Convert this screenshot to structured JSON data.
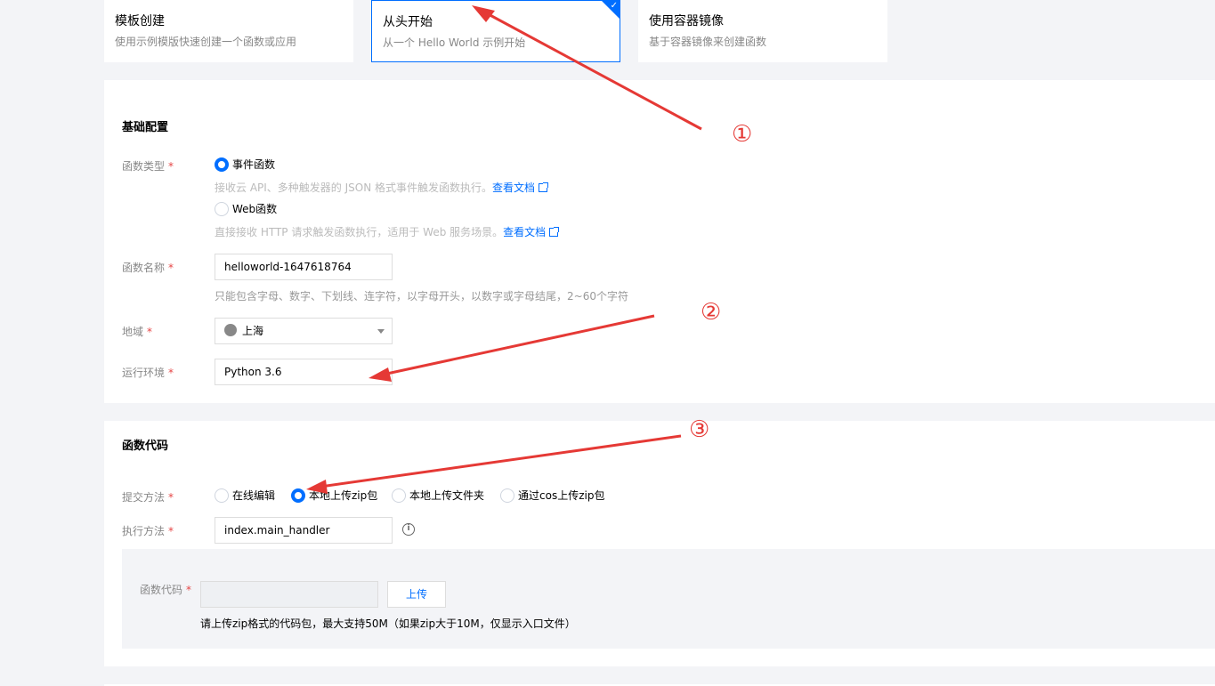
{
  "templates": [
    {
      "title": "模板创建",
      "desc": "使用示例模版快速创建一个函数或应用"
    },
    {
      "title": "从头开始",
      "desc": "从一个 Hello World 示例开始"
    },
    {
      "title": "使用容器镜像",
      "desc": "基于容器镜像来创建函数"
    }
  ],
  "basic": {
    "title": "基础配置",
    "type_label": "函数类型",
    "event_label": "事件函数",
    "event_help": "接收云 API、多种触发器的 JSON 格式事件触发函数执行。",
    "web_label": "Web函数",
    "web_help": "直接接收 HTTP 请求触发函数执行，适用于 Web 服务场景。",
    "doc_link": "查看文档",
    "name_label": "函数名称",
    "name_value": "helloworld-1647618764",
    "name_help": "只能包含字母、数字、下划线、连字符，以字母开头，以数字或字母结尾，2~60个字符",
    "region_label": "地域",
    "region_value": "上海",
    "runtime_label": "运行环境",
    "runtime_value": "Python 3.6",
    "required_mark": "*"
  },
  "code": {
    "title": "函数代码",
    "submit_label": "提交方法",
    "methods": [
      "在线编辑",
      "本地上传zip包",
      "本地上传文件夹",
      "通过cos上传zip包"
    ],
    "handler_label": "执行方法",
    "handler_value": "index.main_handler",
    "code_label": "函数代码",
    "upload_button": "上传",
    "upload_help": "请上传zip格式的代码包，最大支持50M（如果zip大于10M，仅显示入口文件）"
  },
  "annotations": [
    "①",
    "②",
    "③"
  ],
  "colors": {
    "accent": "#006eff",
    "annotation": "#e53935",
    "required": "#e54545"
  }
}
